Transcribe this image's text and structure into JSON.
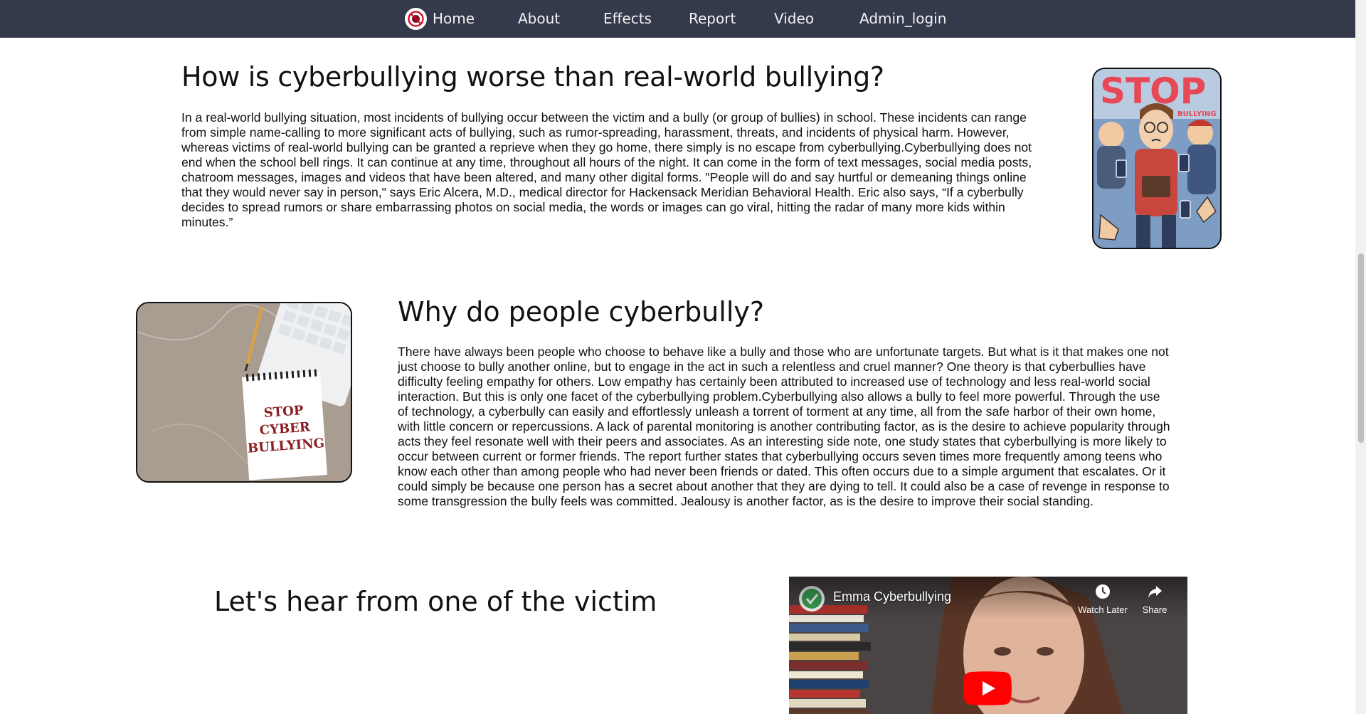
{
  "nav": {
    "items": [
      {
        "label": "Home"
      },
      {
        "label": "About"
      },
      {
        "label": "Effects"
      },
      {
        "label": "Report"
      },
      {
        "label": "Video"
      },
      {
        "label": "Admin_login"
      }
    ]
  },
  "section1": {
    "title": "How is cyberbullying worse than real-world bullying?",
    "paragraph": "In a real-world bullying situation, most incidents of bullying occur between the victim and a bully (or group of bullies) in school. These incidents can range from simple name-calling to more significant acts of bullying, such as rumor-spreading, harassment, threats, and incidents of physical harm. However, whereas victims of real-world bullying can be granted a reprieve when they go home, there simply is no escape from cyberbullying.Cyberbullying does not end when the school bell rings. It can continue at any time, throughout all hours of the night. It can come in the form of text messages, social media posts, chatroom messages, images and videos that have been altered, and many other digital forms. \"People will do and say hurtful or demeaning things online that they would never say in person,\" says Eric Alcera, M.D., medical director for Hackensack Meridian Behavioral Health. Eric also says, “If a cyberbully decides to spread rumors or share embarrassing photos on social media, the words or images can go viral, hitting the radar of many more kids within minutes.”",
    "image": {
      "stop_text": "STOP",
      "bullying_text": "BULLYING"
    }
  },
  "section2": {
    "title": "Why do people cyberbully?",
    "paragraph": "There have always been people who choose to behave like a bully and those who are unfortunate targets. But what is it that makes one not just choose to bully another online, but to engage in the act in such a relentless and cruel manner? One theory is that cyberbullies have difficulty feeling empathy for others. Low empathy has certainly been attributed to increased use of technology and less real-world social interaction. But this is only one facet of the cyberbullying problem.Cyberbullying also allows a bully to feel more powerful. Through the use of technology, a cyberbully can easily and effortlessly unleash a torrent of torment at any time, all from the safe harbor of their own home, with little concern or repercussions. A lack of parental monitoring is another contributing factor, as is the desire to achieve popularity through acts they feel resonate well with their peers and associates. As an interesting side note, one study states that cyberbullying is more likely to occur between current or former friends. The report further states that cyberbullying occurs seven times more frequently among teens who know each other than among people who had never been friends or dated. This often occurs due to a simple argument that escalates. Or it could simply be because one person has a secret about another that they are dying to tell. It could also be a case of revenge in response to some transgression the bully feels was committed. Jealousy is another factor, as is the desire to improve their social standing.",
    "image": {
      "note_lines": [
        "STOP",
        "CYBER",
        "BULLYING"
      ]
    }
  },
  "section3": {
    "title": "Let's hear from one of the victim",
    "video": {
      "title": "Emma Cyberbullying",
      "watch_later": "Watch Later",
      "share": "Share"
    }
  },
  "colors": {
    "navbar_bg": "#343a4b",
    "nav_text": "#f1f3f6",
    "youtube_red": "#ff0000"
  }
}
